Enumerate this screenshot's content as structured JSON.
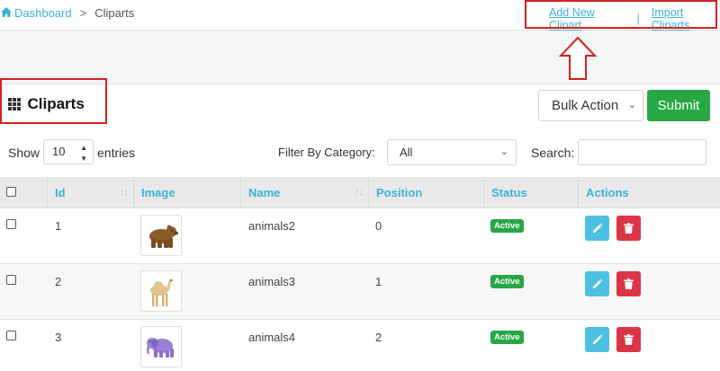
{
  "breadcrumb": {
    "home": "Dashboard",
    "separator": ">",
    "current": "Cliparts"
  },
  "top_links": {
    "add": "Add New Clipart",
    "divider": "|",
    "import": "Import Cliparts"
  },
  "panel": {
    "title": "Cliparts",
    "bulk_action": {
      "selected": "Bulk Action"
    },
    "submit_label": "Submit"
  },
  "controls": {
    "show_label": "Show",
    "length_value": "10",
    "entries_label": "entries",
    "filter_label": "Filter By Category:",
    "category_value": "All",
    "search_label": "Search:",
    "search_value": ""
  },
  "table": {
    "headers": {
      "id": "Id",
      "image": "Image",
      "name": "Name",
      "position": "Position",
      "status": "Status",
      "actions": "Actions"
    },
    "rows": [
      {
        "id": "1",
        "name": "animals2",
        "position": "0",
        "status": "Active",
        "image_icon": "bear-clipart-icon"
      },
      {
        "id": "2",
        "name": "animals3",
        "position": "1",
        "status": "Active",
        "image_icon": "camel-clipart-icon"
      },
      {
        "id": "3",
        "name": "animals4",
        "position": "2",
        "status": "Active",
        "image_icon": "elephant-clipart-icon"
      }
    ]
  },
  "colors": {
    "accent": "#3ab1d8",
    "submit": "#28a745",
    "edit": "#4cc0e0",
    "delete": "#dc3545",
    "highlight": "#d62020"
  }
}
